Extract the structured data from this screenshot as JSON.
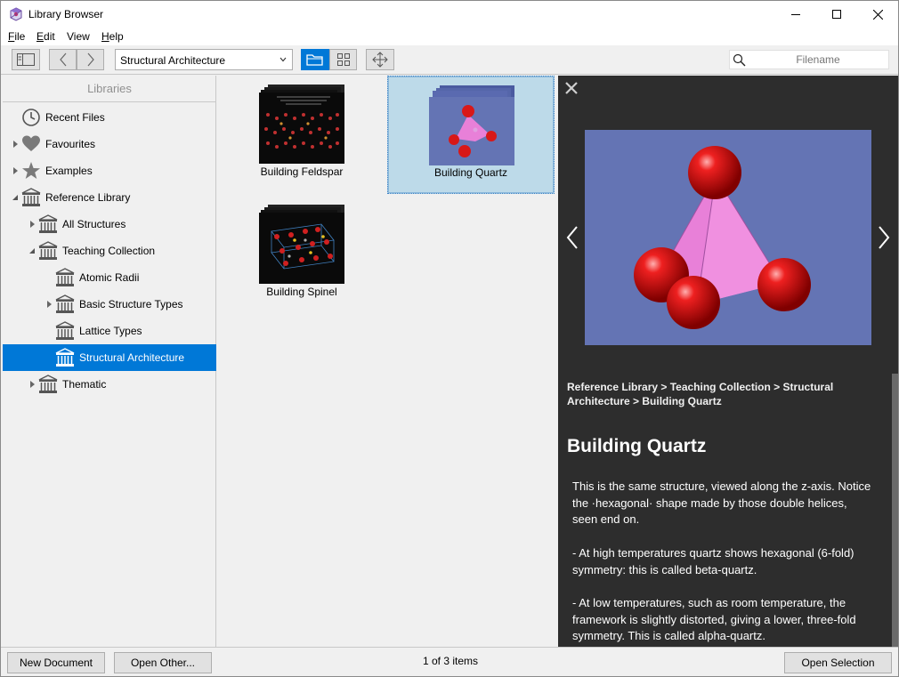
{
  "window": {
    "title": "Library Browser",
    "menu": [
      {
        "key": "F",
        "rest": "ile"
      },
      {
        "key": "E",
        "rest": "dit"
      },
      {
        "key": "",
        "rest": "View"
      },
      {
        "key": "H",
        "rest": "elp"
      }
    ]
  },
  "toolbar": {
    "library_combo": "Structural Architecture",
    "search_placeholder": "Filename"
  },
  "sidebar": {
    "header": "Libraries",
    "items": [
      {
        "label": "Recent Files",
        "icon": "clock-icon",
        "expander": "none",
        "selected": false
      },
      {
        "label": "Favourites",
        "icon": "heart-icon",
        "expander": "collapsed",
        "selected": false
      },
      {
        "label": "Examples",
        "icon": "star-icon",
        "expander": "collapsed",
        "selected": false
      },
      {
        "label": "Reference Library",
        "icon": "library-icon",
        "expander": "expanded",
        "selected": false
      },
      {
        "label": "All Structures",
        "icon": "library-icon",
        "expander": "collapsed",
        "selected": false
      },
      {
        "label": "Teaching Collection",
        "icon": "library-icon",
        "expander": "expanded",
        "selected": false
      },
      {
        "label": "Atomic Radii",
        "icon": "library-icon",
        "expander": "none",
        "selected": false
      },
      {
        "label": "Basic Structure Types",
        "icon": "library-icon",
        "expander": "collapsed",
        "selected": false
      },
      {
        "label": "Lattice Types",
        "icon": "library-icon",
        "expander": "none",
        "selected": false
      },
      {
        "label": "Structural Architecture",
        "icon": "library-icon",
        "expander": "none",
        "selected": true
      },
      {
        "label": "Thematic",
        "icon": "library-icon",
        "expander": "collapsed",
        "selected": false
      }
    ]
  },
  "content": {
    "documents": [
      {
        "caption": "Building Feldspar",
        "selected": false
      },
      {
        "caption": "Building Quartz",
        "selected": true
      },
      {
        "caption": "Building Spinel",
        "selected": false
      }
    ]
  },
  "preview": {
    "breadcrumb": "Reference Library > Teaching Collection > Structural Architecture > Building Quartz",
    "title": "Building Quartz",
    "paragraphs": [
      "This is the same structure, viewed along the z-axis. Notice the ·hexagonal· shape made by those double helices, seen end on.",
      "- At high temperatures quartz shows hexagonal (6-fold) symmetry: this is called beta-quartz.",
      "- At low temperatures, such as room temperature, the framework is slightly distorted, giving a lower, three-fold symmetry. This is called alpha-quartz."
    ]
  },
  "footer": {
    "new_document": "New Document",
    "open_other": "Open Other...",
    "status": "1 of 3 items",
    "open_selection": "Open Selection"
  },
  "colors": {
    "selection": "#0078d7",
    "preview_background": "#2d2d2d",
    "hero_background": "#6474b4",
    "selected_thumb": "#bddae9"
  }
}
